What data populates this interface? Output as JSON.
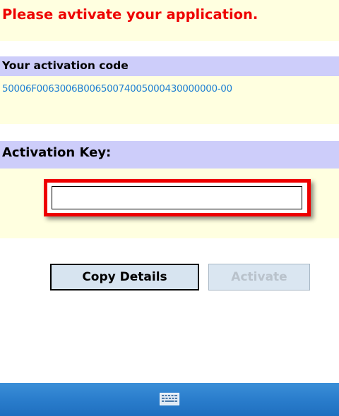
{
  "header": {
    "title": "Please avtivate your application."
  },
  "activation_code": {
    "label": "Your activation code",
    "value": "50006F0063006B00650074005000430000000-00"
  },
  "activation_key": {
    "label": "Activation Key:",
    "value": ""
  },
  "buttons": {
    "copy_details": "Copy Details",
    "activate": "Activate"
  },
  "taskbar": {
    "icon": "keyboard-icon"
  },
  "colors": {
    "title_text": "#ee0000",
    "code_text": "#1e7fd2",
    "header_band": "#cdcdfa",
    "body_band": "#ffffe0",
    "highlight_frame": "#ee0000",
    "taskbar": "#2a7dcc"
  }
}
